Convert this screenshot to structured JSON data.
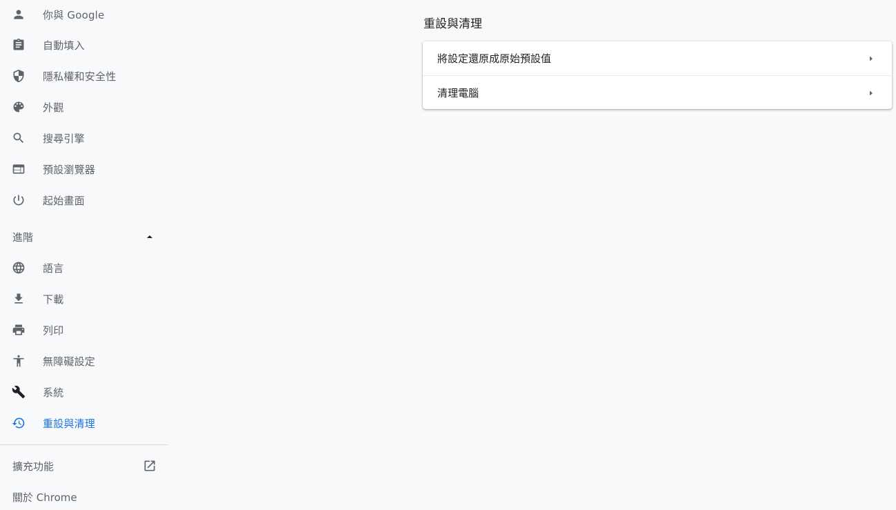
{
  "sidebar": {
    "items": [
      {
        "label": "你與 Google",
        "icon": "person-icon"
      },
      {
        "label": "自動填入",
        "icon": "clipboard-icon"
      },
      {
        "label": "隱私權和安全性",
        "icon": "shield-icon"
      },
      {
        "label": "外觀",
        "icon": "palette-icon"
      },
      {
        "label": "搜尋引擎",
        "icon": "search-icon"
      },
      {
        "label": "預設瀏覽器",
        "icon": "browser-icon"
      },
      {
        "label": "起始畫面",
        "icon": "power-icon"
      }
    ],
    "advanced": {
      "label": "進階",
      "expanded": true,
      "items": [
        {
          "label": "語言",
          "icon": "globe-icon"
        },
        {
          "label": "下載",
          "icon": "download-icon"
        },
        {
          "label": "列印",
          "icon": "printer-icon"
        },
        {
          "label": "無障礙設定",
          "icon": "accessibility-icon"
        },
        {
          "label": "系統",
          "icon": "wrench-icon"
        },
        {
          "label": "重設與清理",
          "icon": "restore-icon",
          "active": true
        }
      ]
    },
    "extensions_label": "擴充功能",
    "about_label": "關於 Chrome"
  },
  "main": {
    "title": "重設與清理",
    "rows": [
      {
        "label": "將設定還原成原始預設值"
      },
      {
        "label": "清理電腦"
      }
    ]
  },
  "colors": {
    "background": "#f8f9fa",
    "accent": "#1a73e8",
    "icon": "#5f6368",
    "text": "#202124"
  }
}
